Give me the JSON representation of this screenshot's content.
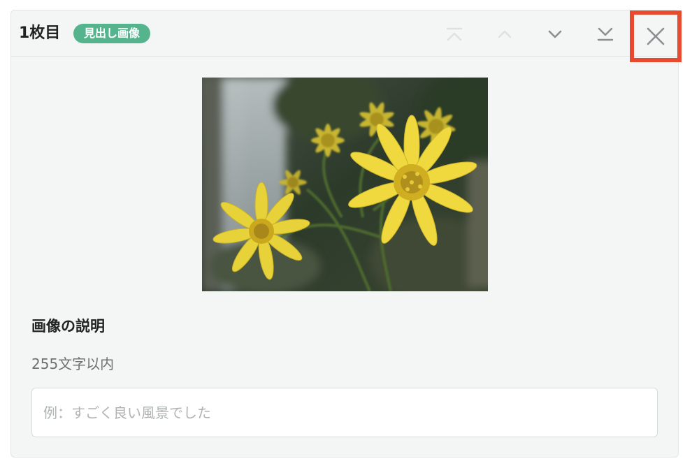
{
  "card": {
    "order_label": "1枚目",
    "badge_label": "見出し画像"
  },
  "controls": {
    "icons": [
      "move-to-top-icon",
      "move-up-icon",
      "move-down-icon",
      "move-to-bottom-icon",
      "close-icon"
    ],
    "close_highlight_color": "#e84a2f"
  },
  "image": {
    "subject": "yellow-flowers-photo"
  },
  "description": {
    "title": "画像の説明",
    "hint": "255文字以内",
    "placeholder": "例：すごく良い風景でした",
    "value": ""
  },
  "colors": {
    "badge": "#55b38e",
    "card_background": "#f4f6f6"
  }
}
